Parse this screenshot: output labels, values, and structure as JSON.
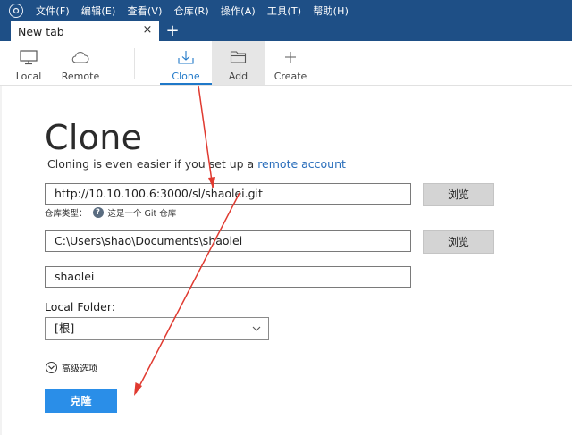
{
  "menu": {
    "items": [
      "文件(F)",
      "编辑(E)",
      "查看(V)",
      "仓库(R)",
      "操作(A)",
      "工具(T)",
      "帮助(H)"
    ]
  },
  "tabs": {
    "current": "New tab",
    "close_glyph": "×",
    "new_glyph": "+"
  },
  "toolbar": {
    "local": "Local",
    "remote": "Remote",
    "clone": "Clone",
    "add": "Add",
    "create": "Create"
  },
  "main": {
    "title": "Clone",
    "subtitle_prefix": "Cloning is even easier if you set up a ",
    "subtitle_link": "remote account",
    "source_url": "http://10.10.100.6:3000/sl/shaolei.git",
    "browse_label": "浏览",
    "repo_type_label": "仓库类型：",
    "repo_type_value": "这是一个 Git 仓库",
    "help_glyph": "?",
    "dest_path": "C:\\Users\\shao\\Documents\\shaolei",
    "name": "shaolei",
    "local_folder_label": "Local Folder:",
    "local_folder_value": "[根]",
    "advanced_label": "高级选项",
    "clone_button": "克隆"
  },
  "colors": {
    "title_bar": "#1e4f86",
    "accent": "#1f78c8",
    "primary_button": "#2a8ee8",
    "annotation_arrow": "#e03a30"
  }
}
